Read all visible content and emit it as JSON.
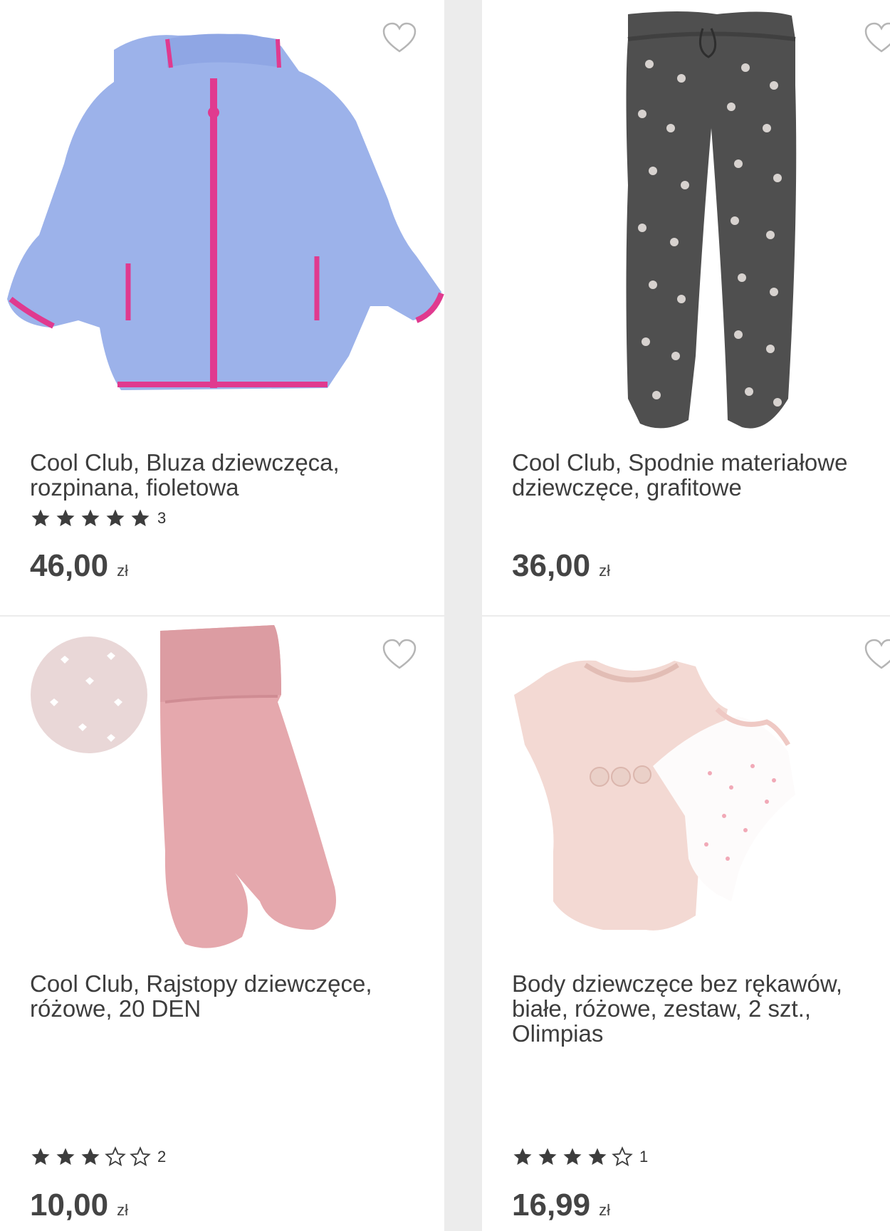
{
  "products": [
    {
      "title_lines": [
        "Cool Club, Bluza dziewczęca,",
        "rozpinana, fioletowa"
      ],
      "rating": 5,
      "rating_count": "3",
      "price": "46,00",
      "currency": "zł",
      "image": "blue-fleece-jacket"
    },
    {
      "title_lines": [
        "Cool Club, Spodnie materiałowe",
        "dziewczęce, grafitowe"
      ],
      "rating": null,
      "rating_count": "",
      "price": "36,00",
      "currency": "zł",
      "image": "grey-polka-dot-pants"
    },
    {
      "title_lines": [
        "Cool Club, Rajstopy dziewczęce,",
        "różowe, 20 DEN"
      ],
      "rating": 3,
      "rating_count": "2",
      "price": "10,00",
      "currency": "zł",
      "image": "pink-tights"
    },
    {
      "title_lines": [
        "Body dziewczęce bez rękawów,",
        "białe, różowe, zestaw, 2 szt.,",
        "Olimpias"
      ],
      "rating": 4,
      "rating_count": "1",
      "price": "16,99",
      "currency": "zł",
      "image": "pink-white-bodysuits"
    }
  ],
  "colors": {
    "star": "#3d3d3d",
    "heart": "#b5b5b5",
    "divider": "#ececec"
  }
}
